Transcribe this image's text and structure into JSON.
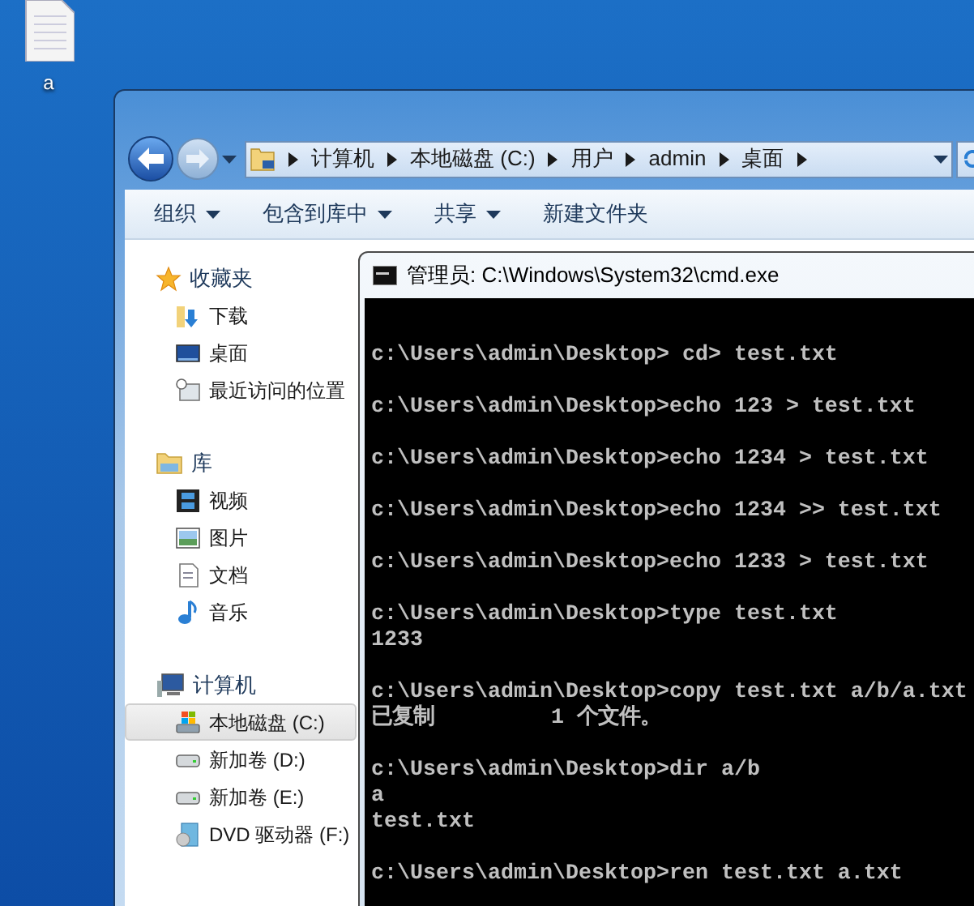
{
  "desktop_icon": {
    "label": "a"
  },
  "explorer": {
    "breadcrumb": [
      "计算机",
      "本地磁盘 (C:)",
      "用户",
      "admin",
      "桌面"
    ],
    "toolbar": [
      {
        "label": "组织",
        "dropdown": true
      },
      {
        "label": "包含到库中",
        "dropdown": true
      },
      {
        "label": "共享",
        "dropdown": true
      },
      {
        "label": "新建文件夹",
        "dropdown": false
      }
    ],
    "sidebar": [
      {
        "label": "收藏夹",
        "children": [
          {
            "label": "下载",
            "selected": false
          },
          {
            "label": "桌面",
            "selected": false
          },
          {
            "label": "最近访问的位置",
            "selected": false
          }
        ]
      },
      {
        "label": "库",
        "children": [
          {
            "label": "视频",
            "selected": false
          },
          {
            "label": "图片",
            "selected": false
          },
          {
            "label": "文档",
            "selected": false
          },
          {
            "label": "音乐",
            "selected": false
          }
        ]
      },
      {
        "label": "计算机",
        "children": [
          {
            "label": "本地磁盘 (C:)",
            "selected": true
          },
          {
            "label": "新加卷 (D:)",
            "selected": false
          },
          {
            "label": "新加卷 (E:)",
            "selected": false
          },
          {
            "label": "DVD 驱动器 (F:)",
            "selected": false
          }
        ]
      }
    ]
  },
  "cmd": {
    "title": "管理员: C:\\Windows\\System32\\cmd.exe",
    "blocks": [
      [
        "c:\\Users\\admin\\Desktop> cd> test.txt"
      ],
      [
        "c:\\Users\\admin\\Desktop>echo 123 > test.txt"
      ],
      [
        "c:\\Users\\admin\\Desktop>echo 1234 > test.txt"
      ],
      [
        "c:\\Users\\admin\\Desktop>echo 1234 >> test.txt"
      ],
      [
        "c:\\Users\\admin\\Desktop>echo 1233 > test.txt"
      ],
      [
        "c:\\Users\\admin\\Desktop>type test.txt",
        "1233"
      ],
      [
        "c:\\Users\\admin\\Desktop>copy test.txt a/b/a.txt",
        "已复制         1 个文件。"
      ],
      [
        "c:\\Users\\admin\\Desktop>dir a/b",
        "a",
        "test.txt"
      ],
      [
        "c:\\Users\\admin\\Desktop>ren test.txt a.txt"
      ]
    ]
  }
}
